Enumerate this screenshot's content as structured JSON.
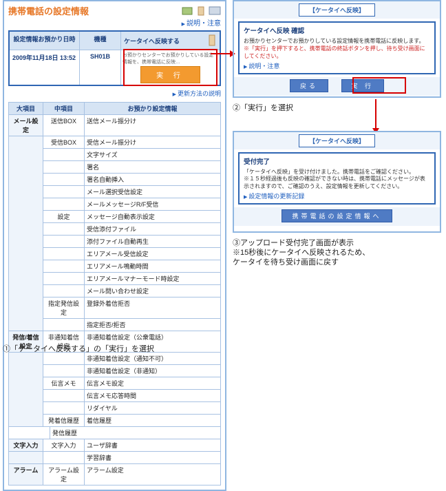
{
  "left": {
    "title": "携帯電話の設定情報",
    "help_link": "説明・注意",
    "info": {
      "col1": "設定情報お預かり日時",
      "col2": "機種",
      "col3": "ケータイへ反映する",
      "col3_desc": "お預かりセンターでお預かりしている設定情報を、携帯電話に反映…",
      "date": "2009年11月18日 13:52",
      "model": "SH01B",
      "exec": "実  行",
      "update_link": "更新方法の説明"
    },
    "thead": {
      "c1": "大項目",
      "c2": "中項目",
      "c3": "お預かり設定情報"
    },
    "rows": [
      {
        "g": "メール設定",
        "span": 16,
        "m": "送信BOX",
        "s": "送信メール振分け"
      },
      {
        "m": "受信BOX",
        "s": "受信メール振分け"
      },
      {
        "s": "文字サイズ"
      },
      {
        "s": "署名"
      },
      {
        "s": "署名自動挿入"
      },
      {
        "s": "メール選択受信設定"
      },
      {
        "s": "メールメッセージR/F受信"
      },
      {
        "m": "設定",
        "s": "メッセージ自動表示設定"
      },
      {
        "s": "受信添付ファイル"
      },
      {
        "s": "添付ファイル自動再生"
      },
      {
        "s": "エリアメール受信設定"
      },
      {
        "s": "エリアメール鳴動時間"
      },
      {
        "s": "エリアメールマナーモード時設定"
      },
      {
        "s": "メール問い合わせ設定"
      },
      {
        "m": "指定発信設定",
        "s": "登録外着信拒否"
      },
      {
        "s": "指定拒否/拒否"
      },
      {
        "g": "発信/着信設定",
        "span": 7,
        "m": "非通知着信設定",
        "s": "非通知着信設定（公衆電話）"
      },
      {
        "s": "非通知着信設定（通知不可）"
      },
      {
        "s": "非通知着信設定（非通知）"
      },
      {
        "m": "伝言メモ",
        "s": "伝言メモ設定"
      },
      {
        "s": "伝言メモ応答時間"
      },
      {
        "s": "リダイヤル"
      },
      {
        "m": "発着信履歴",
        "s": "着信履歴"
      },
      {
        "s": "発信履歴"
      },
      {
        "g": "文字入力",
        "span": 2,
        "m": "文字入力",
        "s": "ユーザ辞書"
      },
      {
        "s": "学習辞書"
      },
      {
        "g": "アラーム",
        "span": 1,
        "m": "アラーム設定",
        "s": "アラーム設定"
      }
    ]
  },
  "right1": {
    "tab": "【ケータイへ反映】",
    "h": "ケータイへ反映 確認",
    "desc": "お預かりセンターでお預かりしている設定情報を携帯電話に反映します。",
    "warn": "※「実行」を押下すると、携帯電話の終話ボタンを押し、待ち受け画面にしてください。",
    "help_link": "説明・注意",
    "btn_back": "戻る",
    "btn_exec": "実  行"
  },
  "right2": {
    "tab": "【ケータイへ反映】",
    "h": "受付完了",
    "l1": "「ケータイへ反映」を受け付けました。携帯電話をご確認ください。",
    "l2": "※１５秒経過後も反映の確認ができない時は、携帯電話にメッセージが表示されますので、ご確認のうえ、設定情報を更新してください。",
    "link": "設定情報の更新記録",
    "btn": "携帯電話の設定情報へ"
  },
  "captions": {
    "c1": "①「ケータイへ反映する」の「実行」を選択",
    "c2": "②「実行」を選択",
    "c3a": "③アップロード受付完了画面が表示",
    "c3b": "※15秒後にケータイへ反映されるため、",
    "c3c": "ケータイを待ち受け画面に戻す"
  }
}
